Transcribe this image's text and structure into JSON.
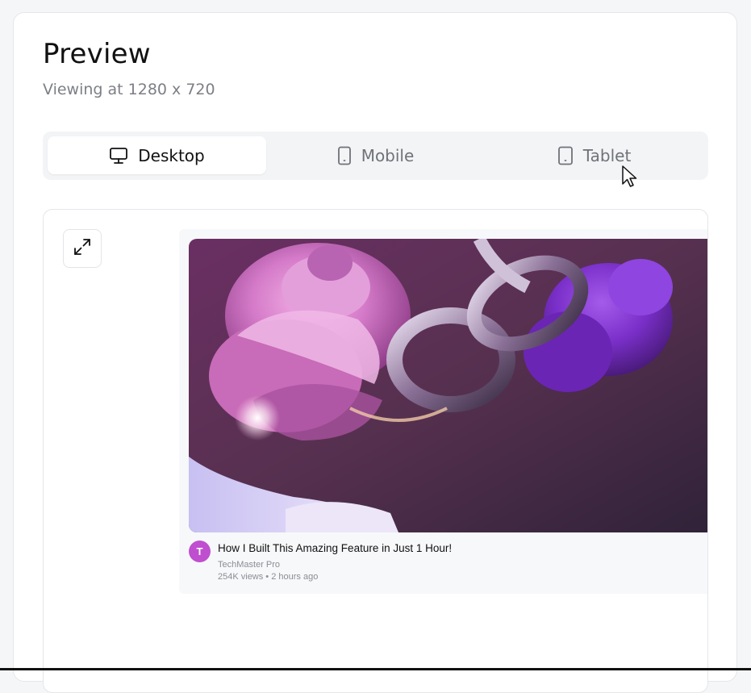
{
  "header": {
    "title": "Preview",
    "subtitle": "Viewing at 1280 x 720"
  },
  "device_tabs": [
    {
      "label": "Desktop",
      "icon": "monitor-icon",
      "active": true
    },
    {
      "label": "Mobile",
      "icon": "phone-icon",
      "active": false
    },
    {
      "label": "Tablet",
      "icon": "tablet-icon",
      "active": false
    }
  ],
  "preview": {
    "expand_icon": "expand-icon",
    "video": {
      "avatar_letter": "T",
      "avatar_color": "#bf4fcf",
      "title": "How I Built This Amazing Feature in Just 1 Hour!",
      "channel": "TechMaster Pro",
      "meta": "254K views • 2 hours ago"
    }
  },
  "colors": {
    "accent": "#bf4fcf",
    "page_background": "#f5f6f8"
  }
}
